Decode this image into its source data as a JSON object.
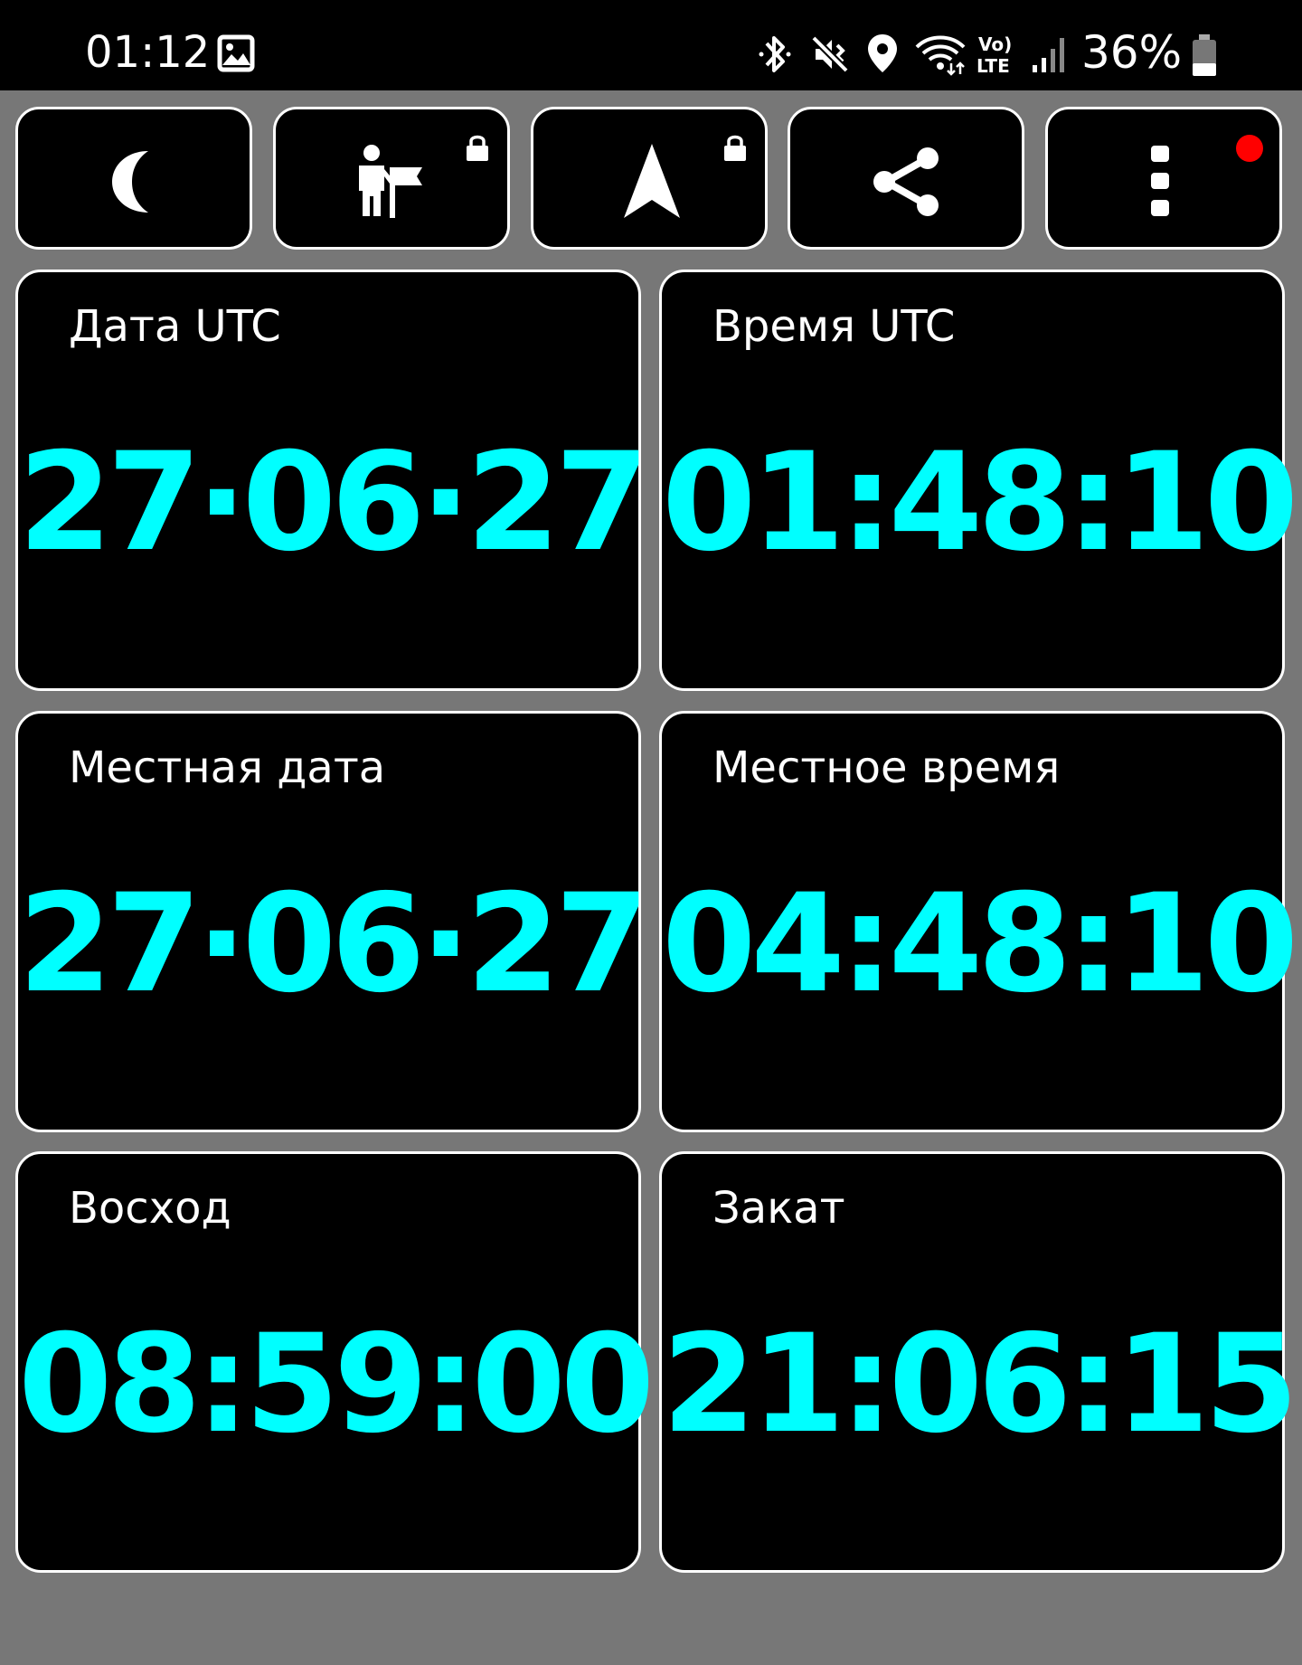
{
  "status_bar": {
    "time": "01:12",
    "battery_percent": "36%",
    "icons": [
      "gallery-icon",
      "bluetooth-icon",
      "vibrate-mute-icon",
      "location-icon",
      "wifi-icon",
      "volte-icon",
      "signal-icon",
      "battery-icon"
    ]
  },
  "toolbar": {
    "buttons": [
      {
        "name": "night-mode",
        "icon": "moon-icon",
        "locked": false
      },
      {
        "name": "waypoint",
        "icon": "person-flag-icon",
        "locked": true
      },
      {
        "name": "navigation",
        "icon": "navigation-arrow-icon",
        "locked": true
      },
      {
        "name": "share",
        "icon": "share-icon",
        "locked": false
      },
      {
        "name": "more",
        "icon": "more-vertical-icon",
        "notification_dot": true
      }
    ],
    "colors": {
      "notification_dot": "#ff0000"
    }
  },
  "tiles": [
    {
      "label": "Дата UTC",
      "value": "27·06·27"
    },
    {
      "label": "Время UTC",
      "value": "01:48:10"
    },
    {
      "label": "Местная дата",
      "value": "27·06·27"
    },
    {
      "label": "Местное время",
      "value": "04:48:10"
    },
    {
      "label": "Восход",
      "value": "08:59:00"
    },
    {
      "label": "Закат",
      "value": "21:06:15"
    }
  ],
  "colors": {
    "background": "#777777",
    "tile_bg": "#000000",
    "value_text": "#00ffff",
    "label_text": "#ffffff"
  }
}
